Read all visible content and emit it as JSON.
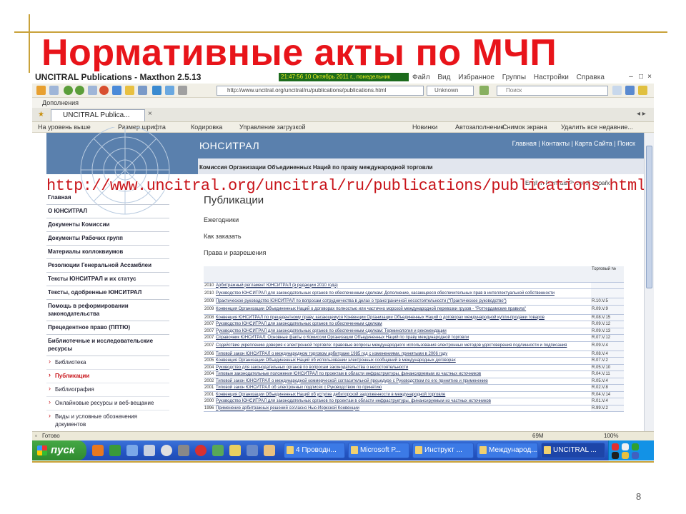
{
  "slide": {
    "title": "Нормативные акты по МЧП",
    "page_number": "8"
  },
  "browser": {
    "window_title": "UNCITRAL Publications - Maxthon 2.5.13",
    "clock_text": "21:47:56 10 Октябрь 2011 г., понедельник",
    "menu": [
      "Файл",
      "Вид",
      "Избранное",
      "Группы",
      "Настройки",
      "Справка"
    ],
    "address": "http://www.uncitral.org/uncitral/ru/publications/publications.html",
    "zone_label": "Unknown",
    "search_placeholder": "Поиск",
    "addons_label": "Дополнения",
    "tab_label": "UNCITRAL Publica...",
    "favorites": [
      "На уровень выше",
      "Размер шрифта",
      "Кодировка",
      "Управление загрузкой",
      "Новинки",
      "Автозаполнение",
      "Снимок экрана",
      "Удалить все недавние..."
    ]
  },
  "site": {
    "brand": "ЮНСИТРАЛ",
    "top_links": "Главная | Контакты | Карта Сайта | Поиск",
    "commission": "Комиссия Организации Объединенных Наций по праву международной торговли",
    "url_overlay": "http://www.uncitral.org/uncitral/ru/publications/publications.html",
    "languages": "English  Français  Русский  Español"
  },
  "sidebar": {
    "items": [
      "Главная",
      "О ЮНСИТРАЛ",
      "Документы Комиссии",
      "Документы Рабочих групп",
      "Материалы коллоквиумов",
      "Резолюции Генеральной Ассамблеи",
      "Тексты ЮНСИТРАЛ и их статус",
      "Тексты, одобренные ЮНСИТРАЛ",
      "Помощь в реформировании законодательства",
      "Прецедентное право (ППТЮ)",
      "Библиотечные и исследовательские ресурсы"
    ],
    "subitems": [
      "Библиотека",
      "Публикации",
      "Библиография",
      "Онлайновые ресурсы и веб-вещание",
      "Виды и условные обозначения документов"
    ]
  },
  "main": {
    "title": "Публикации",
    "links": [
      "Ежегодники",
      "Как заказать",
      "Права и разрешения"
    ],
    "table_header_number": "Торговый №",
    "rows": [
      {
        "year": "2010",
        "title": "Арбитражный регламент ЮНСИТРАЛ (в редакции 2010 года)",
        "no": ""
      },
      {
        "year": "2010",
        "title": "Руководство ЮНСИТРАЛ для законодательных органов по обеспеченным сделкам: Дополнение, касающееся обеспечительных прав в интеллектуальной собственности",
        "no": ""
      },
      {
        "year": "2009",
        "title": "Практическое руководство ЮНСИТРАЛ по вопросам сотрудничества в делах о трансграничной несостоятельности (\"Практическое руководство\")",
        "no": "R.10.V.5"
      },
      {
        "year": "2009",
        "title": "Конвенция Организации Объединенных Наций о договорах полностью или частично морской международной перевозки грузов - \"Роттердамские правила\"",
        "no": "R.09.V.9"
      },
      {
        "year": "2008",
        "title": "Конвенция ЮНСИТРАЛ по прецедентному праву, касающемуся Конвенции Организации Объединенных Наций о договорах международной купли-продажи товаров",
        "no": "R.08.V.15"
      },
      {
        "year": "2007",
        "title": "Руководство ЮНСИТРАЛ для законодательных органов по обеспеченным сделкам",
        "no": "R.09.V.12"
      },
      {
        "year": "2007",
        "title": "Руководство ЮНСИТРАЛ для законодательных органов по обеспеченным сделкам: Терминология и рекомендации",
        "no": "R.09.V.13"
      },
      {
        "year": "2007",
        "title": "Справочник ЮНСИТРАЛ: Основные факты о Комиссии Организации Объединенных Наций по праву международной торговли",
        "no": "R.07.V.12"
      },
      {
        "year": "2007",
        "title": "Содействие укреплению доверия к электронной торговле: правовые вопросы международного использования электронных методов удостоверения подлинности и подписания",
        "no": "R.09.V.4"
      },
      {
        "year": "2006",
        "title": "Типовой закон ЮНСИТРАЛ о международном торговом арбитраже 1985 год с изменениями, принятыми в 2006 году",
        "no": "R.08.V.4"
      },
      {
        "year": "2005",
        "title": "Конвенция Организации Объединенных Наций об использовании электронных сообщений в международных договорах",
        "no": "R.07.V.2"
      },
      {
        "year": "2004",
        "title": "Руководство для законодательных органов по вопросам законодательства о несостоятельности",
        "no": "R.05.V.10"
      },
      {
        "year": "2004",
        "title": "Типовые законодательные положения ЮНСИТРАЛ по проектам в области инфраструктуры, финансируемым из частных источников",
        "no": "R.04.V.11"
      },
      {
        "year": "2002",
        "title": "Типовой закон ЮНСИТРАЛ о международной коммерческой согласительной процедуре с Руководством по его принятию и применению",
        "no": "R.05.V.4"
      },
      {
        "year": "2001",
        "title": "Типовой закон ЮНСИТРАЛ об электронных подписях с Руководством по принятию",
        "no": "R.02.V.8"
      },
      {
        "year": "2001",
        "title": "Конвенция Организации Объединенных Наций об уступке дебиторской задолженности в международной торговле",
        "no": "R.04.V.14"
      },
      {
        "year": "2000",
        "title": "Руководство ЮНСИТРАЛ для законодательных органов по проектам в области инфраструктуры, финансируемым из частных источников",
        "no": "R.01.V.4"
      },
      {
        "year": "1996",
        "title": "Применение арбитражных решений согласно Нью-Йоркской Конвенции",
        "no": "R.99.V.2"
      }
    ]
  },
  "status": {
    "left": "Готово",
    "size": "69M",
    "zoom": "100%"
  },
  "taskbar": {
    "start": "пуск",
    "tasks": [
      "4 Проводн...",
      "Microsoft P...",
      "Инструкт ...",
      "Международ...",
      "UNCITRAL ..."
    ]
  }
}
